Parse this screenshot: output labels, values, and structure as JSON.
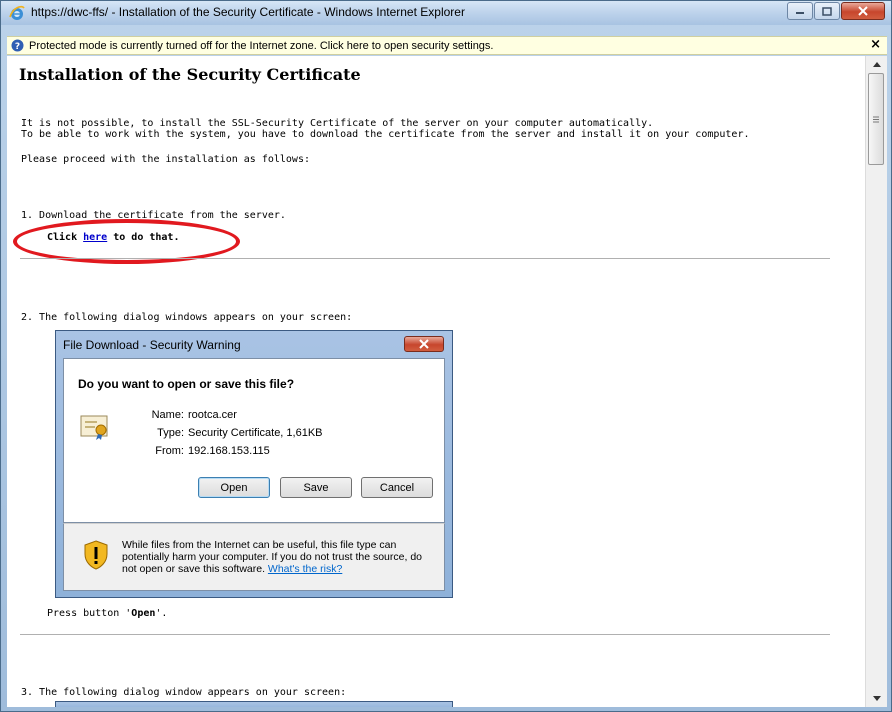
{
  "window": {
    "title": "https://dwc-ffs/ - Installation of the Security Certificate - Windows Internet Explorer",
    "minimize_label": "Minimize",
    "maximize_label": "Maximize",
    "close_label": "Close"
  },
  "infobar": {
    "text": "Protected mode is currently turned off for the Internet zone.  Click here to open security settings.",
    "close": "×"
  },
  "page": {
    "heading": "Installation of the Security Certificate",
    "intro_line1": "It is not possible, to install the SSL-Security Certificate of the server on your computer automatically.",
    "intro_line2": "To be able to work with the system, you have to download the certificate from the server and install it on your computer.",
    "proceed": "Please proceed with the installation as follows:",
    "step1": "1. Download the certificate from the server.",
    "step1_click_prefix": "Click ",
    "step1_link": "here",
    "step1_click_suffix": " to do that.",
    "step2": "2. The following dialog windows appears on your screen:",
    "press_prefix": "Press button '",
    "press_button": "Open",
    "press_suffix": "'.",
    "step3": "3. The following dialog window appears on your screen:"
  },
  "dialog": {
    "title": "File Download - Security Warning",
    "question": "Do you want to open or save this file?",
    "name_label": "Name:",
    "name_value": "rootca.cer",
    "type_label": "Type:",
    "type_value": "Security Certificate, 1,61KB",
    "from_label": "From:",
    "from_value": "192.168.153.115",
    "open_button": "Open",
    "save_button": "Save",
    "cancel_button": "Cancel",
    "warning_text": "While files from the Internet can be useful, this file type can potentially harm your computer. If you do not trust the source, do not open or save this software. ",
    "warning_link": "What's the risk?"
  },
  "colors": {
    "highlight_ellipse": "#e1191f",
    "link": "#0000cc",
    "infobar_bg": "#ffffe1"
  }
}
